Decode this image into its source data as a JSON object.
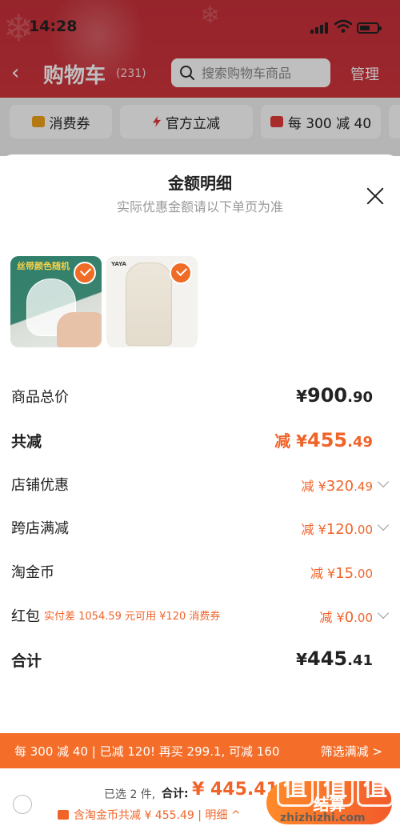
{
  "status": {
    "time": "14:28"
  },
  "nav": {
    "title": "购物车",
    "count": "(231)",
    "search_placeholder": "搜索购物车商品",
    "manage": "管理"
  },
  "chips": [
    {
      "label": "消费券",
      "icon": "coupon-icon"
    },
    {
      "label": "官方立减",
      "icon": "lightning-icon"
    },
    {
      "label": "每 300 减 40",
      "icon": "red-envelope-icon"
    }
  ],
  "sheet": {
    "title": "金额明细",
    "subtitle": "实际优惠金额请以下单页为准",
    "products": [
      {
        "tag": "丝带颜色随机",
        "checked": true
      },
      {
        "brand": "YAYA",
        "checked": true
      }
    ],
    "rows": {
      "goods_total": {
        "label": "商品总价",
        "currency": "¥",
        "int": "900",
        "dec": ".90"
      },
      "total_discount": {
        "label": "共减",
        "prefix": "减 ¥",
        "int": "455",
        "dec": ".49"
      },
      "shop_discount": {
        "label": "店铺优惠",
        "prefix": "减 ¥",
        "int": "320",
        "dec": ".49"
      },
      "cross_shop": {
        "label": "跨店满减",
        "prefix": "减 ¥",
        "int": "120",
        "dec": ".00"
      },
      "taojinbi": {
        "label": "淘金币",
        "prefix": "减 ¥",
        "int": "15",
        "dec": ".00"
      },
      "hongbao": {
        "label": "红包",
        "note": "实付差 1054.59 元可用 ¥120 消费券",
        "prefix": "减 ¥",
        "int": "0",
        "dec": ".00"
      },
      "sum": {
        "label": "合计",
        "currency": "¥",
        "int": "445",
        "dec": ".41"
      }
    }
  },
  "promo": {
    "text": "每 300 减 40 | 已减 120! 再买 299.1, 可减 160",
    "filter": "筛选满减 >"
  },
  "checkout": {
    "selected": "已选 2 件,",
    "total_label": "合计:",
    "total_value": "¥ 445.41",
    "detail": "含淘金币共减 ¥ 455.49 | 明细 ^",
    "pay_label": "结算"
  },
  "watermark": {
    "chars": [
      "值",
      "值",
      "值"
    ],
    "url": "zhizhizhi.com"
  },
  "colors": {
    "brand_red": "#c9303a",
    "accent_orange": "#f0642a",
    "promo_bg": "#f46e2a"
  }
}
